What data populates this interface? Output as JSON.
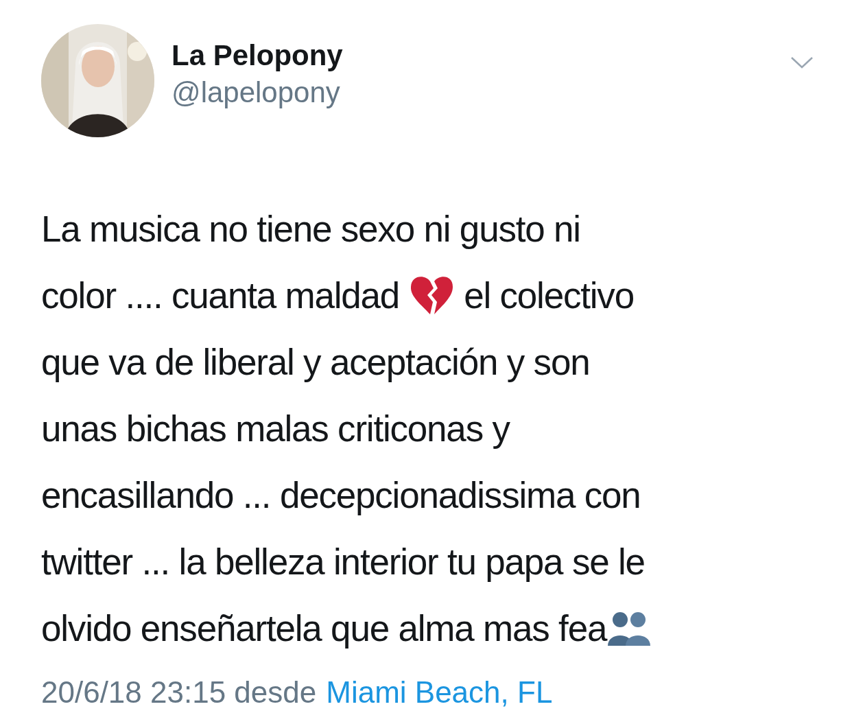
{
  "author": {
    "name": "La Pelopony",
    "handle": "@lapelopony"
  },
  "body": {
    "lines": [
      [
        {
          "kind": "text",
          "text": "La musica no tiene sexo ni gusto ni"
        }
      ],
      [
        {
          "kind": "text",
          "text": "color .... cuanta maldad"
        },
        {
          "kind": "broken-heart"
        },
        {
          "kind": "text",
          "text": "el colectivo"
        }
      ],
      [
        {
          "kind": "text",
          "text": "que va de liberal y aceptación y son"
        }
      ],
      [
        {
          "kind": "text",
          "text": "unas bichas malas criticonas y"
        }
      ],
      [
        {
          "kind": "text",
          "text": "encasillando ... decepcionadissima con"
        }
      ],
      [
        {
          "kind": "text",
          "text": "twitter ... la belleza interior tu papa se le"
        }
      ],
      [
        {
          "kind": "text",
          "text": "olvido enseñartela que alma mas fea"
        },
        {
          "kind": "silhouettes"
        }
      ]
    ]
  },
  "footer": {
    "timestamp": "20/6/18 23:15 desde",
    "location": "Miami Beach, FL"
  }
}
